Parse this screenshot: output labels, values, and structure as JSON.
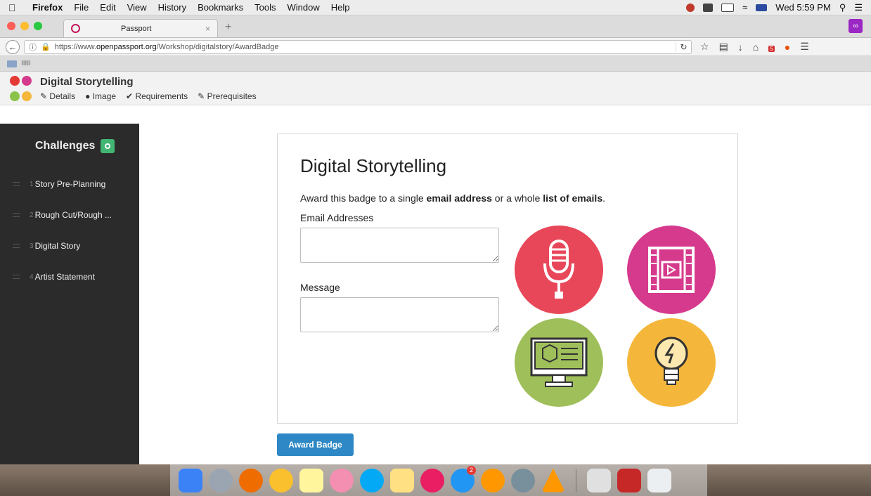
{
  "menubar": {
    "app": "Firefox",
    "items": [
      "File",
      "Edit",
      "View",
      "History",
      "Bookmarks",
      "Tools",
      "Window",
      "Help"
    ],
    "clock": "Wed 5:59 PM"
  },
  "browser": {
    "tab_title": "Passport",
    "url_prefix": "https://www.",
    "url_domain": "openpassport.org",
    "url_path": "/Workshop/digitalstory/AwardBadge",
    "bookmark_label": "IIIII",
    "notification_count": "5"
  },
  "header": {
    "title": "Digital Storytelling",
    "nav": [
      "Details",
      "Image",
      "Requirements",
      "Prerequisites"
    ]
  },
  "sidebar": {
    "title": "Challenges",
    "items": [
      {
        "num": "1",
        "label": "Story Pre-Planning"
      },
      {
        "num": "2",
        "label": "Rough Cut/Rough ..."
      },
      {
        "num": "3",
        "label": "Digital Story"
      },
      {
        "num": "4",
        "label": "Artist Statement"
      }
    ]
  },
  "card": {
    "title": "Digital Storytelling",
    "desc_pre": "Award this badge to a single ",
    "desc_bold1": "email address",
    "desc_mid": " or a whole ",
    "desc_bold2": "list of emails",
    "desc_end": ".",
    "email_label": "Email Addresses",
    "message_label": "Message",
    "award_button": "Award Badge"
  },
  "badges": [
    {
      "name": "microphone-icon",
      "color": "#e8475a"
    },
    {
      "name": "film-icon",
      "color": "#d63a8c"
    },
    {
      "name": "monitor-icon",
      "color": "#9fbf5a"
    },
    {
      "name": "lightbulb-icon",
      "color": "#f5b73b"
    }
  ],
  "dock_badge": "2"
}
